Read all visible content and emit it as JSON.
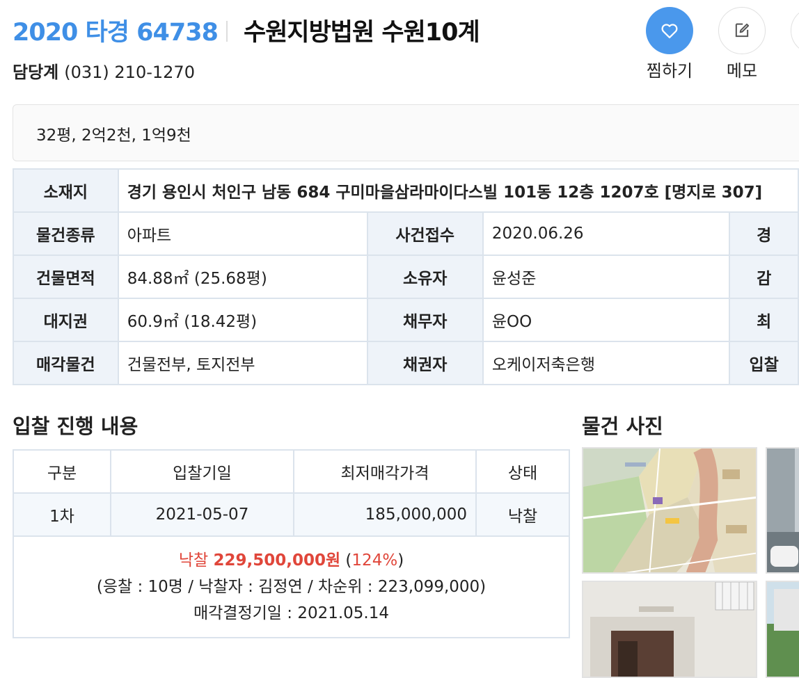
{
  "header": {
    "case_number": "2020 타경 64738",
    "court": "수원지방법원 수원10계",
    "contact_label": "담당계",
    "contact_phone": "(031) 210-1270"
  },
  "actions": {
    "favorite_label": "찜하기",
    "memo_label": "메모",
    "accent": "#4a98ec"
  },
  "summary": "32평, 2억2천, 1억9천",
  "info": {
    "address_label": "소재지",
    "address": "경기 용인시 처인구 남동 684 구미마을삼라마이다스빌 101동 12층 1207호 [명지로 307]",
    "rows": [
      {
        "h1": "물건종류",
        "v1": "아파트",
        "h2": "사건접수",
        "v2": "2020.06.26",
        "h3": "경"
      },
      {
        "h1": "건물면적",
        "v1": "84.88㎡ (25.68평)",
        "h2": "소유자",
        "v2": "윤성준",
        "h3": "감"
      },
      {
        "h1": "대지권",
        "v1": "60.9㎡ (18.42평)",
        "h2": "채무자",
        "v2": "윤OO",
        "h3": "최"
      },
      {
        "h1": "매각물건",
        "v1": "건물전부, 토지전부",
        "h2": "채권자",
        "v2": "오케이저축은행",
        "h3": "입찰"
      }
    ]
  },
  "bidding": {
    "section_title": "입찰 진행 내용",
    "columns": [
      "구분",
      "입찰기일",
      "최저매각가격",
      "상태"
    ],
    "rows": [
      {
        "round": "1차",
        "date": "2021-05-07",
        "min_price": "185,000,000",
        "status": "낙찰"
      }
    ],
    "result": {
      "label": "낙찰",
      "amount": "229,500,000원",
      "percent": "124%",
      "line2": "(응찰 : 10명 / 낙찰자 : 김정연 / 차순위 : 223,099,000)",
      "line3": "매각결정기일 : 2021.05.14"
    }
  },
  "photos": {
    "section_title": "물건 사진"
  }
}
